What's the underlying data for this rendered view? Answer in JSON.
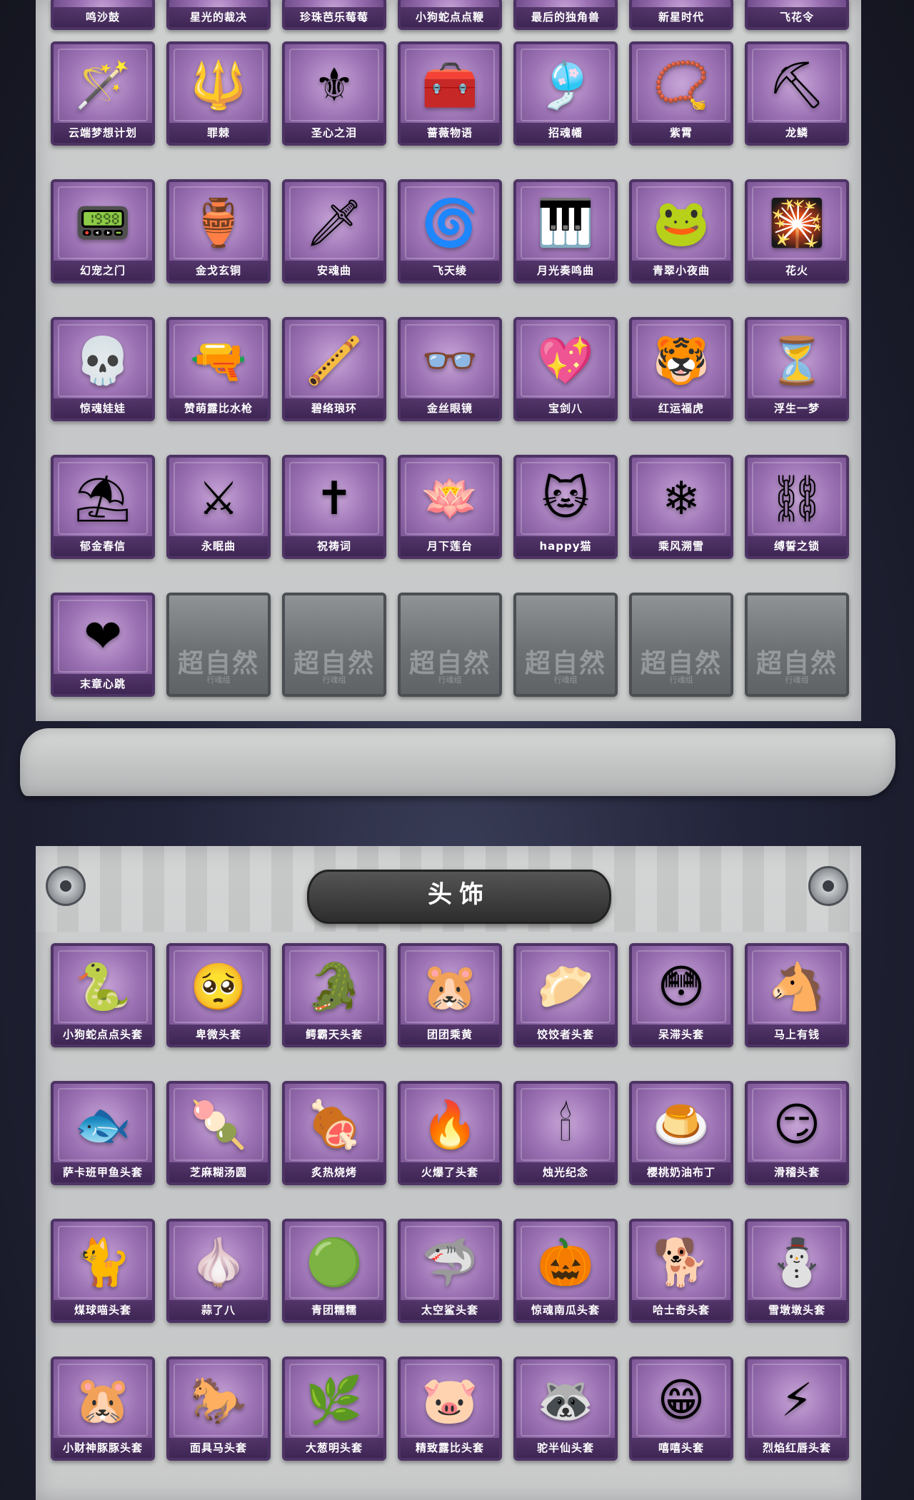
{
  "section_headwear": {
    "title": "头饰"
  },
  "top_partial_row": [
    {
      "label": "鸣沙鼓"
    },
    {
      "label": "星光的裁决"
    },
    {
      "label": "珍珠芭乐莓莓"
    },
    {
      "label": "小狗蛇点点鞭"
    },
    {
      "label": "最后的独角兽"
    },
    {
      "label": "新星时代"
    },
    {
      "label": "飞花令"
    }
  ],
  "items": [
    {
      "label": "云端梦想计划",
      "icon": "wand-icon",
      "glyph": "🪄"
    },
    {
      "label": "罪棘",
      "icon": "spear-icon",
      "glyph": "🔱"
    },
    {
      "label": "圣心之泪",
      "icon": "scepter-icon",
      "glyph": "⚜"
    },
    {
      "label": "蔷薇物语",
      "icon": "first-aid-case-icon",
      "glyph": "🧰"
    },
    {
      "label": "招魂幡",
      "icon": "banner-icon",
      "glyph": "🎐"
    },
    {
      "label": "紫霄",
      "icon": "prayer-beads-icon",
      "glyph": "📿"
    },
    {
      "label": "龙鳞",
      "icon": "golden-shovel-icon",
      "glyph": "⛏"
    },
    {
      "label": "幻宠之门",
      "icon": "pet-device-icon",
      "glyph": "📟"
    },
    {
      "label": "金戈玄铜",
      "icon": "bronze-cannon-icon",
      "glyph": "🏺"
    },
    {
      "label": "安魂曲",
      "icon": "blade-icon",
      "glyph": "🗡"
    },
    {
      "label": "飞天绫",
      "icon": "ribbon-scroll-icon",
      "glyph": "🌀"
    },
    {
      "label": "月光奏鸣曲",
      "icon": "piano-icon",
      "glyph": "🎹"
    },
    {
      "label": "青翠小夜曲",
      "icon": "frog-icon",
      "glyph": "🐸"
    },
    {
      "label": "花火",
      "icon": "sparkler-icon",
      "glyph": "🎇"
    },
    {
      "label": "惊魂娃娃",
      "icon": "skull-doll-icon",
      "glyph": "💀"
    },
    {
      "label": "赞萌露比水枪",
      "icon": "water-gun-icon",
      "glyph": "🔫"
    },
    {
      "label": "碧络琅环",
      "icon": "jade-staff-icon",
      "glyph": "🪈"
    },
    {
      "label": "金丝眼镜",
      "icon": "glasses-icon",
      "glyph": "👓"
    },
    {
      "label": "宝剑八",
      "icon": "heart-shield-icon",
      "glyph": "💖"
    },
    {
      "label": "红运福虎",
      "icon": "tiger-icon",
      "glyph": "🐯"
    },
    {
      "label": "浮生一梦",
      "icon": "hourglass-icon",
      "glyph": "⏳"
    },
    {
      "label": "郁金春信",
      "icon": "umbrella-icon",
      "glyph": "⛱"
    },
    {
      "label": "永眠曲",
      "icon": "purple-sword-icon",
      "glyph": "⚔"
    },
    {
      "label": "祝祷词",
      "icon": "cross-pendant-icon",
      "glyph": "✝"
    },
    {
      "label": "月下莲台",
      "icon": "lotus-mirror-icon",
      "glyph": "🪷"
    },
    {
      "label": "happy猫",
      "icon": "cat-icon",
      "glyph": "🐱"
    },
    {
      "label": "乘风溯雪",
      "icon": "snow-lantern-icon",
      "glyph": "❄"
    },
    {
      "label": "缚誓之锁",
      "icon": "chain-staff-icon",
      "glyph": "⛓"
    },
    {
      "label": "末章心跳",
      "icon": "heart-staff-icon",
      "glyph": "❤"
    }
  ],
  "locked_cards": [
    {
      "stamp": "超自然",
      "sub": "行魂组"
    },
    {
      "stamp": "超自然",
      "sub": "行魂组"
    },
    {
      "stamp": "超自然",
      "sub": "行魂组"
    },
    {
      "stamp": "超自然",
      "sub": "行魂组"
    },
    {
      "stamp": "超自然",
      "sub": "行魂组"
    },
    {
      "stamp": "超自然",
      "sub": "行魂组"
    }
  ],
  "headwear_items": [
    {
      "label": "小狗蛇点点头套",
      "icon": "snake-head-icon",
      "glyph": "🐍"
    },
    {
      "label": "卑微头套",
      "icon": "shy-face-icon",
      "glyph": "🥺"
    },
    {
      "label": "鳄霸天头套",
      "icon": "crocodile-icon",
      "glyph": "🐊"
    },
    {
      "label": "团团乘黄",
      "icon": "cream-cat-icon",
      "glyph": "🐹"
    },
    {
      "label": "饺饺者头套",
      "icon": "dumpling-icon",
      "glyph": "🥟"
    },
    {
      "label": "呆滞头套",
      "icon": "dazed-face-icon",
      "glyph": "😳"
    },
    {
      "label": "马上有钱",
      "icon": "horse-mask-icon",
      "glyph": "🐴"
    },
    {
      "label": "萨卡班甲鱼头套",
      "icon": "fish-head-icon",
      "glyph": "🐟"
    },
    {
      "label": "芝麻糊汤圆",
      "icon": "rice-ball-icon",
      "glyph": "🍡"
    },
    {
      "label": "炙热烧烤",
      "icon": "bbq-icon",
      "glyph": "🍖"
    },
    {
      "label": "火爆了头套",
      "icon": "flame-icon",
      "glyph": "🔥"
    },
    {
      "label": "烛光纪念",
      "icon": "candle-icon",
      "glyph": "🕯"
    },
    {
      "label": "樱桃奶油布丁",
      "icon": "pudding-icon",
      "glyph": "🍮"
    },
    {
      "label": "滑稽头套",
      "icon": "funny-face-icon",
      "glyph": "😏"
    },
    {
      "label": "煤球喵头套",
      "icon": "gray-cat-icon",
      "glyph": "🐈"
    },
    {
      "label": "蒜了八",
      "icon": "garlic-icon",
      "glyph": "🧄"
    },
    {
      "label": "青团糯糯",
      "icon": "green-bun-icon",
      "glyph": "🟢"
    },
    {
      "label": "太空鲨头套",
      "icon": "shark-icon",
      "glyph": "🦈"
    },
    {
      "label": "惊魂南瓜头套",
      "icon": "pumpkin-icon",
      "glyph": "🎃"
    },
    {
      "label": "哈士奇头套",
      "icon": "husky-icon",
      "glyph": "🐕"
    },
    {
      "label": "雪墩墩头套",
      "icon": "snow-deer-icon",
      "glyph": "⛄"
    },
    {
      "label": "小财神豚豚头套",
      "icon": "capybara-icon",
      "glyph": "🐹"
    },
    {
      "label": "面具马头套",
      "icon": "horse-head-icon",
      "glyph": "🐎"
    },
    {
      "label": "大葱明头套",
      "icon": "scallion-icon",
      "glyph": "🌿"
    },
    {
      "label": "精致露比头套",
      "icon": "pink-ball-icon",
      "glyph": "🐷"
    },
    {
      "label": "驼半仙头套",
      "icon": "raccoon-icon",
      "glyph": "🦝"
    },
    {
      "label": "嘻嘻头套",
      "icon": "grin-face-icon",
      "glyph": "😁"
    },
    {
      "label": "烈焰红唇头套",
      "icon": "pikachu-icon",
      "glyph": "⚡"
    }
  ]
}
